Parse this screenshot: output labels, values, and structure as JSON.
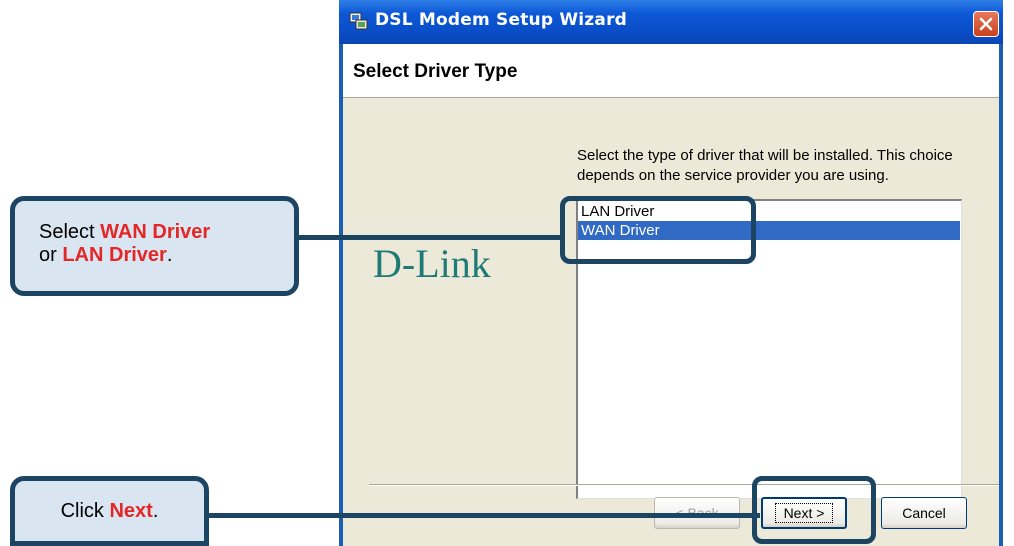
{
  "window": {
    "title": "DSL Modem Setup Wizard",
    "icon": "setup-wizard-icon",
    "close_icon": "close-icon"
  },
  "header": {
    "title": "Select Driver Type"
  },
  "brand": {
    "logo_text": "D-Link",
    "color": "#1e7a76"
  },
  "instruction": "Select the type of driver that will be installed. This choice depends on the service provider you are using.",
  "driver_list": {
    "items": [
      {
        "label": "LAN Driver",
        "selected": false
      },
      {
        "label": "WAN Driver",
        "selected": true
      }
    ]
  },
  "buttons": {
    "back": "< Back",
    "next": "Next >",
    "cancel": "Cancel"
  },
  "callouts": {
    "driver": {
      "prefix": "Select ",
      "opt1": "WAN Driver",
      "mid": "or ",
      "opt2": "LAN Driver",
      "suffix": "."
    },
    "next": {
      "prefix": "Click ",
      "target": "Next",
      "suffix": "."
    }
  },
  "colors": {
    "titlebar": "#0a4ec8",
    "selection": "#316ac5",
    "callout_border": "#1c4463",
    "callout_fill": "#d9e6f1",
    "callout_highlight": "#e52626"
  }
}
